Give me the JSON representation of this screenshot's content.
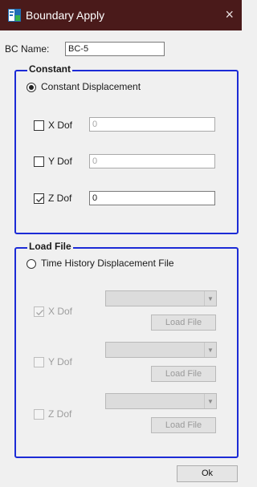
{
  "window": {
    "title": "Boundary Apply",
    "close_glyph": "×"
  },
  "bc_name": {
    "label": "BC Name:",
    "value": "BC-5"
  },
  "constant": {
    "legend": "Constant",
    "mode_label": "Constant Displacement",
    "mode_selected": true,
    "rows": [
      {
        "label": "X Dof",
        "checked": false,
        "value": "0"
      },
      {
        "label": "Y Dof",
        "checked": false,
        "value": "0"
      },
      {
        "label": "Z Dof",
        "checked": true,
        "value": "0"
      }
    ]
  },
  "load_file": {
    "legend": "Load File",
    "mode_label": "Time History Displacement File",
    "mode_selected": false,
    "rows": [
      {
        "label": "X Dof",
        "checked": true,
        "button": "Load File"
      },
      {
        "label": "Y Dof",
        "checked": false,
        "button": "Load File"
      },
      {
        "label": "Z Dof",
        "checked": false,
        "button": "Load File"
      }
    ]
  },
  "ok_button": "Ok",
  "icons": {
    "app": "app-logo-icon",
    "close": "close-icon",
    "dropdown": "chevron-down-icon"
  },
  "colors": {
    "titlebar": "#4a1a1a",
    "group_border": "#1c2bd6"
  }
}
